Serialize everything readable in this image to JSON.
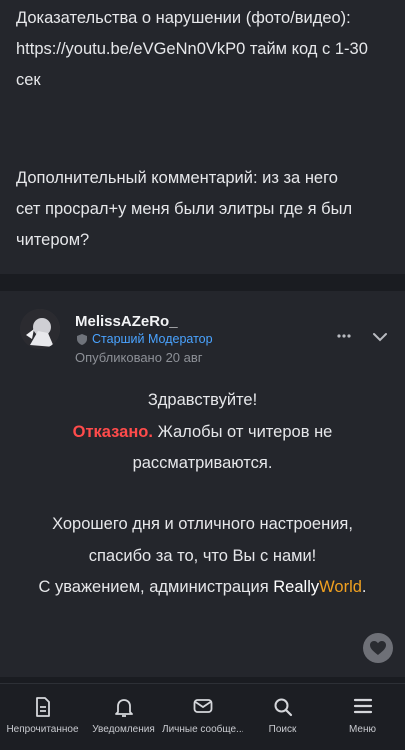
{
  "previous_post": {
    "evidence_line": "Доказательства о нарушении (фото/видео):",
    "evidence_link_line": "https://youtu.be/eVGeNn0VkP0 тайм код с 1-30",
    "evidence_tail": "сек",
    "comment_line1": "Дополнительный комментарий: из за него",
    "comment_line2": "сет просрал+у меня были элитры где я был",
    "comment_line3": "читером?"
  },
  "reply_post": {
    "username": "MelissAZeRo_",
    "role": "Старший Модератор",
    "published": "Опубликовано 20 авг",
    "greeting": "Здравствуйте!",
    "status_word": "Отказано.",
    "status_rest": "Жалобы от читеров не",
    "status_rest2": "рассматриваются.",
    "wish_line1": "Хорошего дня и отличного настроения,",
    "wish_line2": "спасибо за то, что Вы с нами!",
    "signoff_prefix": "С уважением, администрация",
    "brand_part1": "Really",
    "brand_part2": "World",
    "signoff_suffix": "."
  },
  "tabbar": {
    "unread": "Непрочитанное",
    "notifications": "Уведомления",
    "messages": "Личные сообще...",
    "search": "Поиск",
    "menu": "Меню"
  },
  "colors": {
    "accent_blue": "#4aa3ff",
    "denied_red": "#ff4b4b",
    "brand_orange": "#f0a020",
    "card_bg": "#24262c"
  },
  "icons": [
    "shield-icon",
    "more-icon",
    "chevron-down-icon",
    "heart-icon",
    "document-icon",
    "bell-icon",
    "mail-icon",
    "search-icon",
    "menu-icon"
  ]
}
